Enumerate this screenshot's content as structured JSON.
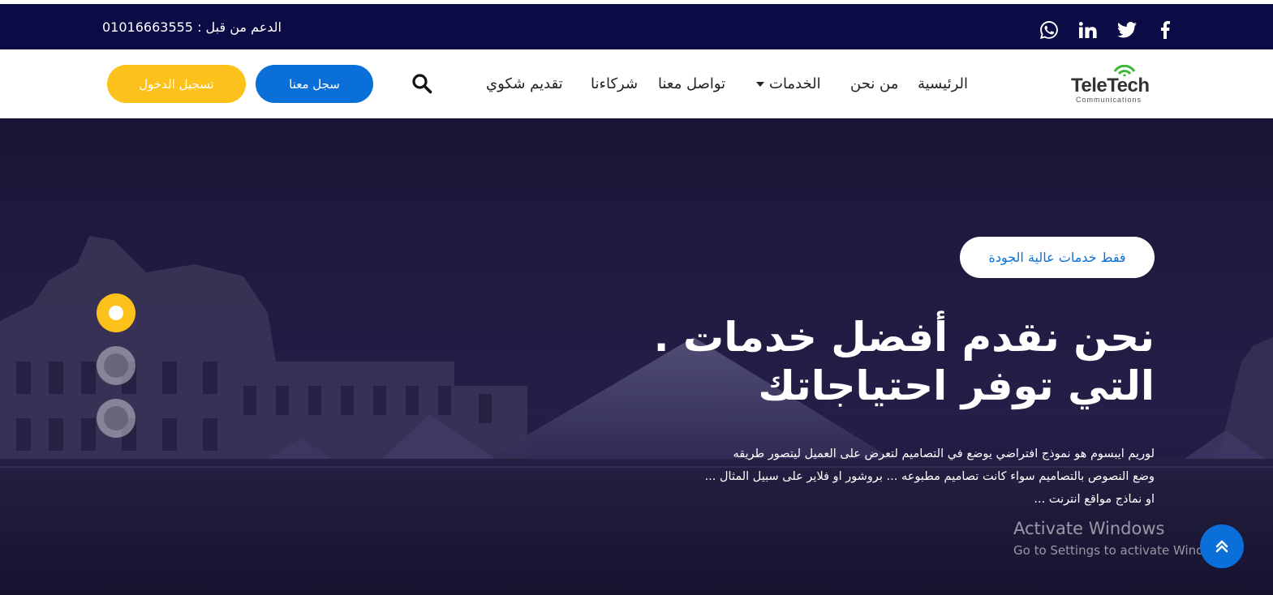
{
  "topbar": {
    "support_label": "الدعم من قبل : 01016663555",
    "social": [
      "facebook-icon",
      "twitter-icon",
      "linkedin-icon",
      "whatsapp-icon"
    ],
    "background": "#0b0b45"
  },
  "logo": {
    "name": "TeleTech",
    "sub": "Communications"
  },
  "nav": {
    "home": "الرئيسية",
    "about": "من نحن",
    "services": "الخدمات",
    "contact": "تواصل معنا",
    "partners": "شركاءنا",
    "complaint": "تقديم شكوي"
  },
  "buttons": {
    "register": "سجل معنا",
    "login": "تسجيل الدخول"
  },
  "hero": {
    "badge": "فقط خدمات عالية الجودة",
    "headline_line1": "نحن نقدم أفضل خدمات .",
    "headline_line2": "التي توفر احتياجاتك",
    "description_line1": "لوريم ايبسوم هو نموذج افتراضي يوضع في التصاميم لتعرض على العميل ليتصور طريقه",
    "description_line2": "وضع النصوص بالتصاميم سواء كانت تصاميم مطبوعه ... بروشور او فلاير على سبيل المثال ...",
    "description_line3": "او نماذج مواقع انترنت ...",
    "slides_total": 3,
    "slide_active": 1
  },
  "watermark": {
    "title": "Activate Windows",
    "subtitle": "Go to Settings to activate Windows."
  },
  "colors": {
    "accent_blue": "#0a6fd8",
    "accent_yellow": "#fcc21b",
    "navy": "#0b0b45"
  }
}
